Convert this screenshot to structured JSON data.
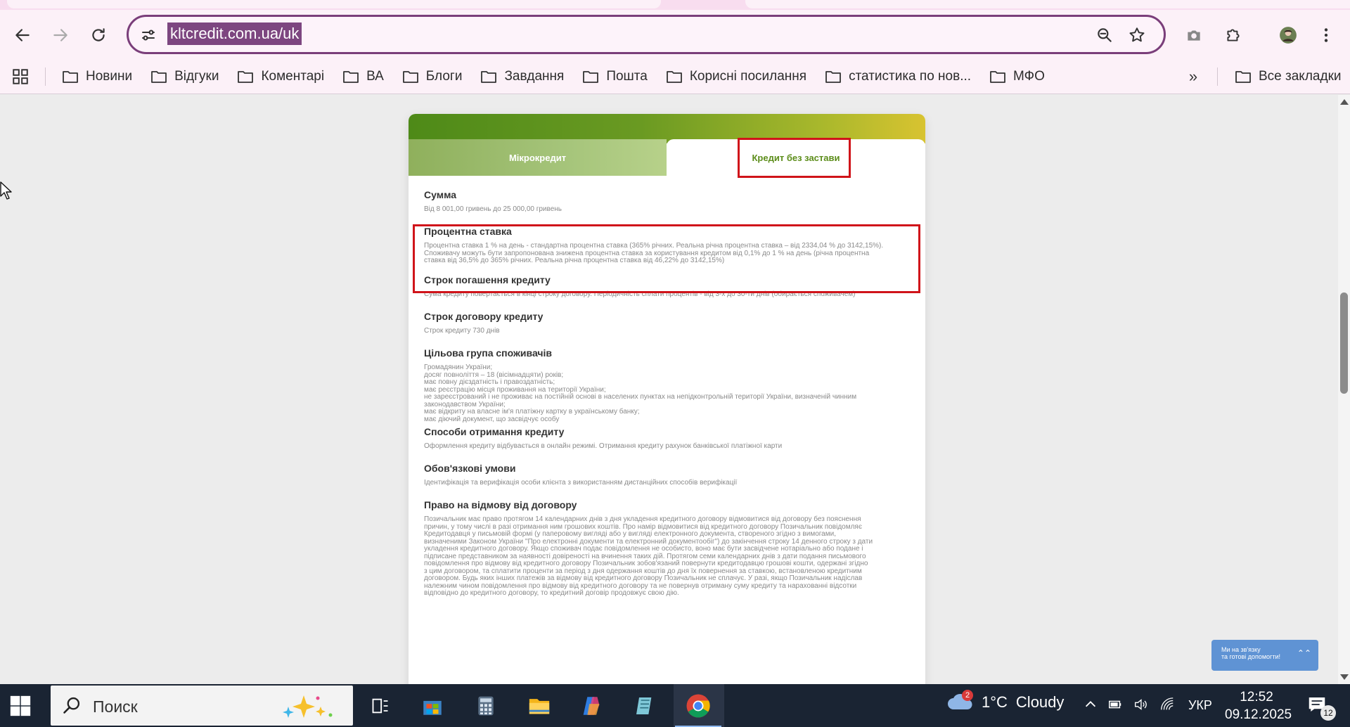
{
  "browser": {
    "url": "kltcredit.com.ua/uk",
    "bookmarks": [
      "Новини",
      "Відгуки",
      "Коментарі",
      "ВА",
      "Блоги",
      "Завдання",
      "Пошта",
      "Корисні посилання",
      "статистика по нов...",
      "МФО"
    ],
    "all_bookmarks": "Все закладки",
    "more_glyph": "»"
  },
  "page": {
    "tabs": {
      "micro": "Мікрокредит",
      "no_collateral": "Кредит без застави"
    },
    "sections": [
      {
        "title": "Сумма",
        "text": "Від 8 001,00 гривень до 25 000,00 гривень"
      },
      {
        "title": "Процентна ставка",
        "text": "Процентна ставка 1 % на день - стандартна процентна ставка (365% річних. Реальна річна процентна ставка – від 2334,04 % до 3142,15%).\nСпоживачу можуть бути запропонована знижена процентна ставка за користування кредитом від 0,1% до 1 % на день (річна процентна\nставка від 36,5% до 365% річних. Реальна річна процентна ставка від 46,22% до 3142,15%)"
      },
      {
        "title": "Строк погашення кредиту",
        "text": "Сума кредиту повертається в кінці строку договору. Періодичність сплати процентів - від 3-х до 30-ти днів (обирається споживачем)"
      },
      {
        "title": "Строк договору кредиту",
        "text": "Строк кредиту 730 днів"
      },
      {
        "title": "Цільова група споживачів",
        "text": "Громадянин України;\nдосяг повноліття – 18 (вісімнадцяти) років;\nмає повну дієздатність і правоздатність;\nмає реєстрацію місця проживання на території України;\nне зареєстрований і не проживає на постійній основі в населених пунктах на непідконтрольній території України, визначеній чинним\nзаконодавством України;\nмає відкриту на власне ім'я платіжну картку в українському банку;\nмає діючий документ, що засвідчує особу"
      },
      {
        "title": "Способи отримання кредиту",
        "text": "Оформлення кредиту відбувається в онлайн режимі. Отримання кредиту рахунок банківської платіжної карти"
      },
      {
        "title": "Обов'язкові умови",
        "text": "Ідентифікація та верифікація особи клієнта з використанням дистанційних способів верифікації"
      },
      {
        "title": "Право на відмову від договору",
        "text": "Позичальник має право протягом 14 календарних днів з дня укладення кредитного договору відмовитися від договору без пояснення\nпричин, у тому числі в разі отримання ним грошових коштів. Про намір відмовитися від кредитного договору Позичальник повідомляє\nКредитодавця у письмовій формі (у паперовому вигляді або у вигляді електронного документа, створеного згідно з вимогами,\nвизначеними Законом України \"Про електронні документи та електронний документообіг\") до закінчення строку 14 денного строку з дати\nукладення кредитного договору. Якщо споживач подає повідомлення не особисто, воно має бути засвідчене нотаріально або подане і\nпідписане представником за наявності довіреності на вчинення таких дій. Протягом семи календарних днів з дати подання письмового\nповідомлення про відмову від кредитного договору Позичальник зобов'язаний повернути кредитодавцю грошові кошти, одержані згідно\nз цим договором, та сплатити проценти за період з дня одержання коштів до дня їх повернення за ставкою, встановленою кредитним\nдоговором. Будь яких інших платежів за відмову від кредитного договору Позичальник не сплачує. У разі, якщо Позичальник надіслав\nналежним чином повідомлення про відмову від кредитного договору та не повернув отриману суму кредиту та нарахованні відсотки\nвідповідно до кредитного договору, то кредитний договір продовжує свою дію."
      }
    ],
    "chat_widget": "Ми на зв'язку\nта готові допомогти!",
    "chat_chevron": "⌃⌃"
  },
  "taskbar": {
    "search_placeholder": "Поиск",
    "weather_temp": "1°C",
    "weather_desc": "Cloudy",
    "weather_badge": "2",
    "language": "УКР",
    "time": "12:52",
    "date": "09.12.2025",
    "notifications": "12"
  },
  "colors": {
    "accent_green": "#5c8d1a",
    "highlight_red": "#d0141a",
    "omnibox_border": "#7a3e7a",
    "url_selection": "#7d4680"
  }
}
